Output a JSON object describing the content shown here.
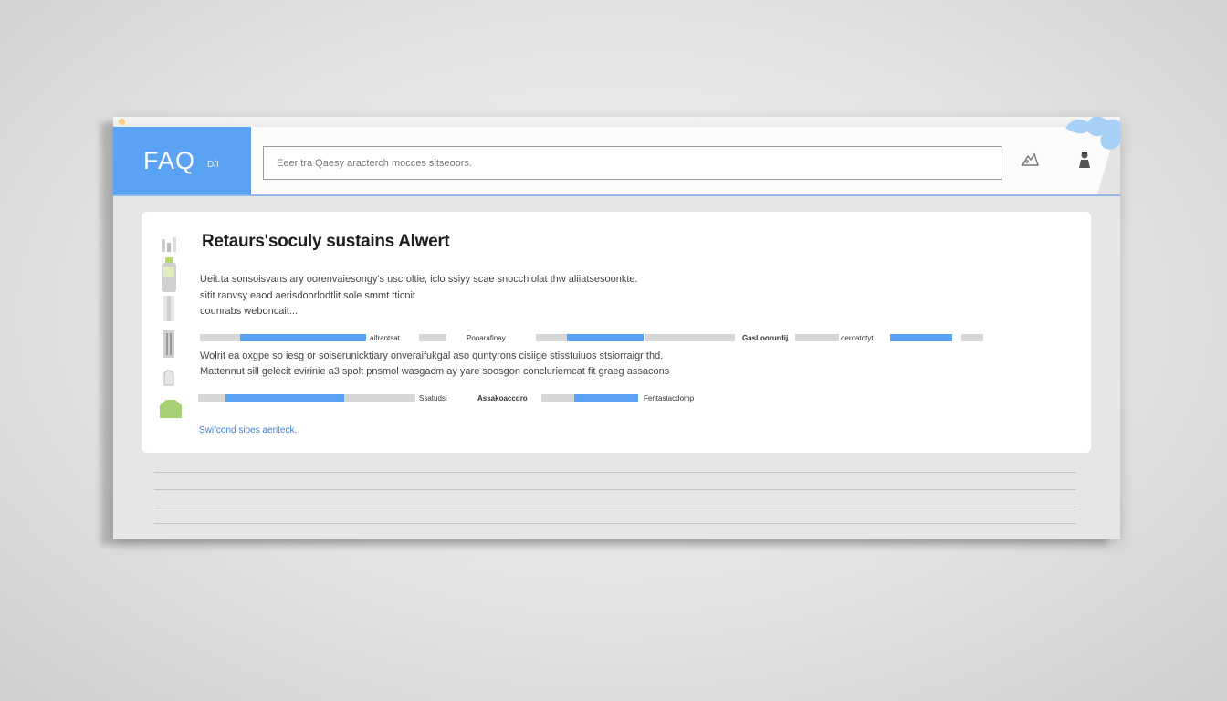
{
  "window": {
    "title": ""
  },
  "header": {
    "brand": "FAQ",
    "brand_sub": "D/I",
    "search": {
      "placeholder": "Eeer tra Qaesy aracterch mocces sitseoors."
    },
    "icons": [
      "tools-icon",
      "user-icon"
    ]
  },
  "article": {
    "title": "Retaurs'soculy sustains Alwert",
    "paragraph1": [
      "Ueit.ta sonsoisvans ary oorenvaiesongy's uscroltie, iclo ssiyy scae snocchiolat thw aliiatsesoonkte.",
      "sitit ranvsy eaod aerisdoorlodtlit sole smmt tticnit",
      "counrabs weboncait..."
    ],
    "paragraph2": [
      "Wolrit ea oxgpe so iesg or soiserunicktiary onveraifukgal aso quntyrons cisiige stisstuiuos stsiorraigr thd.",
      "Mattennut sill gelecit evirinie a3 spolt pnsmol wasgacm ay yare soosgon concluriemcat fit graeg assacons"
    ],
    "inline_labels": {
      "row1_a": "aifrantsat",
      "row1_b": "Pooarafinay",
      "row1_c": "GasLoorurdij",
      "row1_d": "oeroatotyt",
      "row2_a": "Ssatudsi",
      "row2_b": "Assakoaccdro",
      "row2_c": "Fentastacdomp"
    },
    "link": "Swifcond sioes aeriteck."
  },
  "sidebar_icons": [
    "bar-chart-icon",
    "bottle-icon",
    "pillar-icon",
    "column-icon",
    "glove-icon",
    "shirt-icon"
  ]
}
